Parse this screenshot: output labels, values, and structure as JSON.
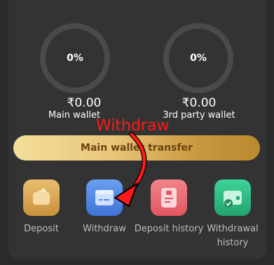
{
  "wallets": {
    "main": {
      "percent": "0%",
      "amount": "₹0.00",
      "label": "Main wallet"
    },
    "third_party": {
      "percent": "0%",
      "amount": "₹0.00",
      "label": "3rd party wallet"
    }
  },
  "transfer_button": {
    "label": "Main wallet transfer"
  },
  "actions": [
    {
      "label": "Deposit",
      "icon": "deposit-icon",
      "color": "#e0b060"
    },
    {
      "label": "Withdraw",
      "icon": "withdraw-icon",
      "color": "#4f86e3"
    },
    {
      "label": "Deposit history",
      "icon": "deposit-history-icon",
      "color": "#f06b73"
    },
    {
      "label": "Withdrawal history",
      "icon": "withdrawal-history-icon",
      "color": "#2fbf83"
    }
  ],
  "annotation": {
    "text": "Withdraw",
    "color": "#ff1a1a"
  }
}
